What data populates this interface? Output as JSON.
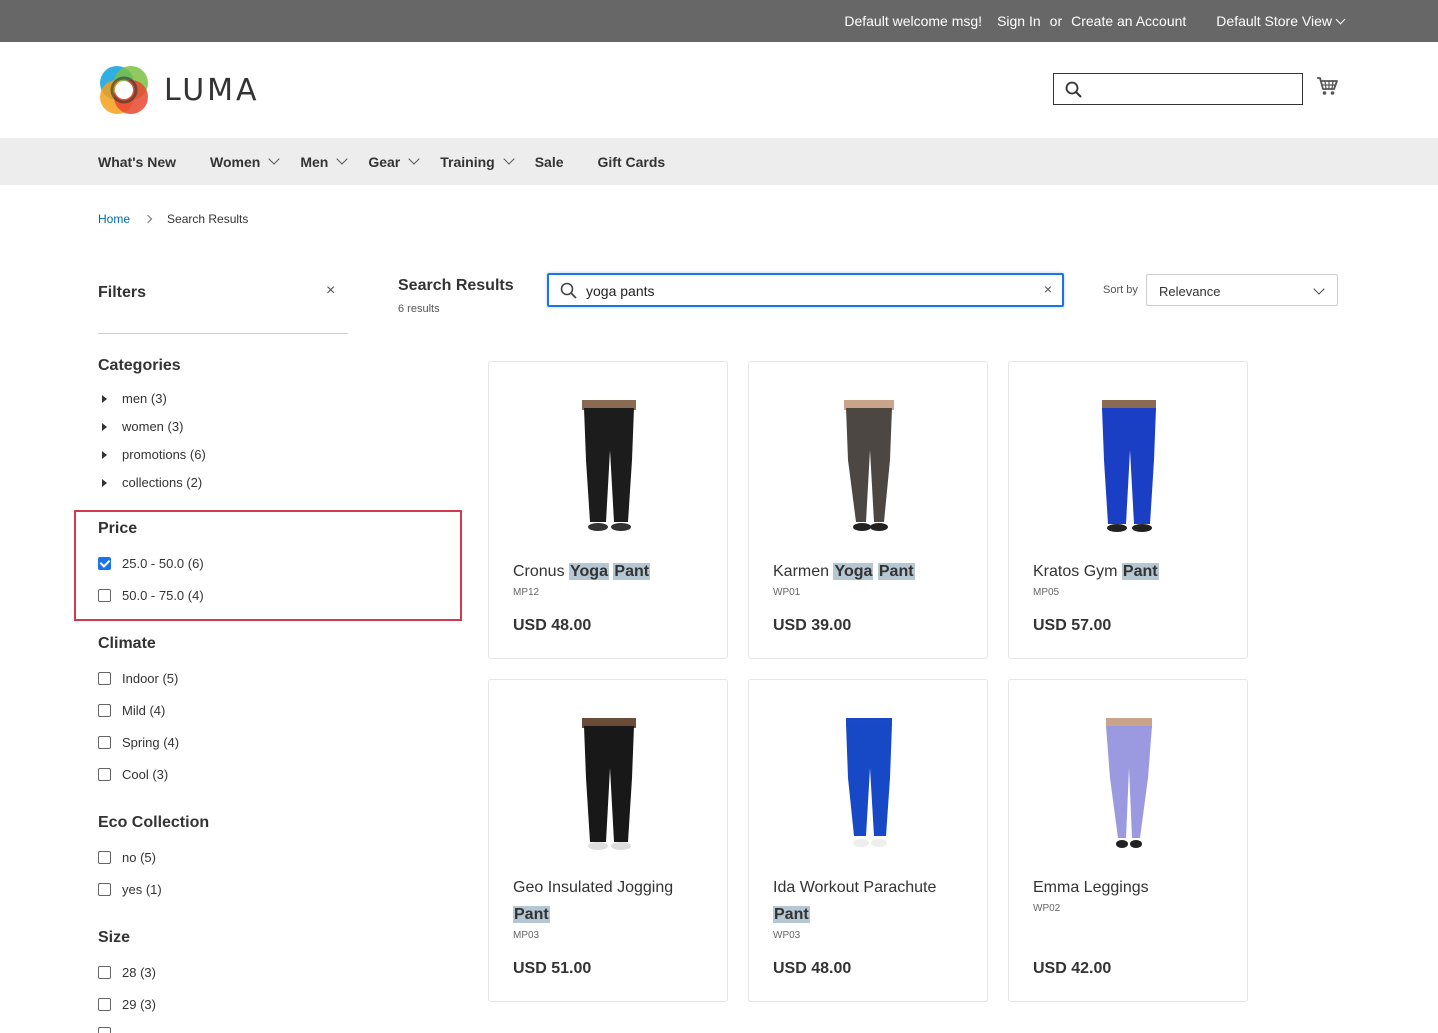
{
  "topbar": {
    "welcome": "Default welcome msg!",
    "sign_in": "Sign In",
    "or": "or",
    "create_account": "Create an Account",
    "store_view": "Default Store View"
  },
  "header": {
    "logo_text": "LUMA",
    "search_value": ""
  },
  "nav": {
    "items": [
      {
        "label": "What's New"
      },
      {
        "label": "Women"
      },
      {
        "label": "Men"
      },
      {
        "label": "Gear"
      },
      {
        "label": "Training"
      },
      {
        "label": "Sale"
      },
      {
        "label": "Gift Cards"
      }
    ]
  },
  "breadcrumb": {
    "home": "Home",
    "current": "Search Results"
  },
  "filters": {
    "title": "Filters",
    "close": "×",
    "categories": {
      "title": "Categories",
      "items": [
        "men (3)",
        "women (3)",
        "promotions (6)",
        "collections (2)"
      ]
    },
    "price": {
      "title": "Price",
      "items": [
        {
          "label": "25.0 - 50.0 (6)",
          "checked": true
        },
        {
          "label": "50.0 - 75.0 (4)",
          "checked": false
        }
      ]
    },
    "climate": {
      "title": "Climate",
      "items": [
        "Indoor (5)",
        "Mild (4)",
        "Spring (4)",
        "Cool (3)"
      ]
    },
    "eco": {
      "title": "Eco Collection",
      "items": [
        "no (5)",
        "yes (1)"
      ]
    },
    "size": {
      "title": "Size",
      "items": [
        "28 (3)",
        "29 (3)"
      ]
    }
  },
  "results": {
    "title": "Search Results",
    "count": "6 results",
    "query": "yoga pants",
    "clear": "×",
    "sort_label": "Sort by",
    "sort_value": "Relevance"
  },
  "products": [
    {
      "name_plain": "Cronus",
      "hl1": "Yoga",
      "hl2": "Pant",
      "sku": "MP12",
      "price": "USD 48.00"
    },
    {
      "name_plain": "Karmen",
      "hl1": "Yoga",
      "hl2": "Pant",
      "sku": "WP01",
      "price": "USD 39.00"
    },
    {
      "name_plain": "Kratos Gym",
      "hl1": "Pant",
      "sku": "MP05",
      "price": "USD 57.00"
    },
    {
      "name_plain": "Geo Insulated Jogging",
      "hl1": "Pant",
      "sku": "MP03",
      "price": "USD 51.00"
    },
    {
      "name_plain": "Ida Workout Parachute",
      "hl1": "Pant",
      "sku": "WP03",
      "price": "USD 48.00"
    },
    {
      "name_plain": "Emma Leggings",
      "sku": "WP02",
      "price": "USD 42.00"
    }
  ],
  "colors": {
    "topbar_bg": "#676767",
    "nav_bg": "#ededed",
    "link": "#006bb4",
    "focus": "#1a73e8",
    "highlight_border": "#d33a4f",
    "term_highlight": "#b5c7d3"
  }
}
